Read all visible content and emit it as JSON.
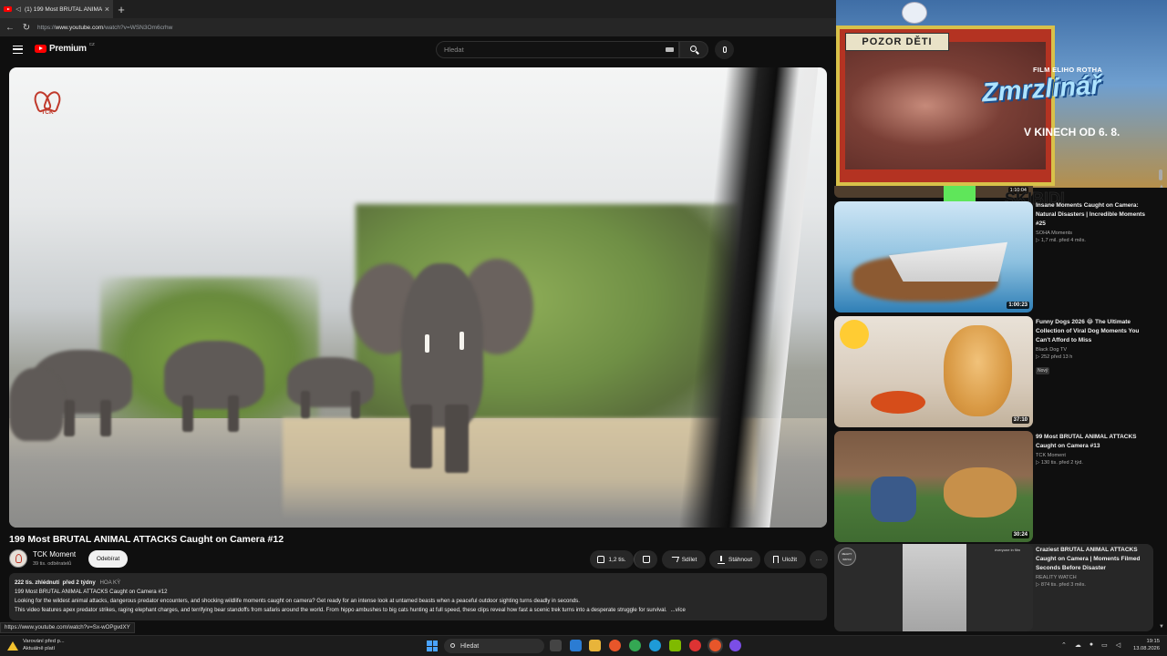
{
  "browser": {
    "tab_title": "(1) 199 Most BRUTAL ANIMAL",
    "url_prefix": "https://",
    "url_domain": "www.youtube.com",
    "url_path": "/watch?v=WSN3Om6crhw"
  },
  "header": {
    "logo_text": "Premium",
    "logo_country": "CZ",
    "search_placeholder": "Hledat"
  },
  "video": {
    "watermark": "TCK",
    "title": "199 Most BRUTAL ANIMAL ATTACKS Caught on Camera #12",
    "channel": "TCK Moment",
    "subscribers": "39 tis. odběratelů",
    "subscribe_label": "Odebírat",
    "likes": "1,2 tis.",
    "share_label": "Sdílet",
    "download_label": "Stáhnout",
    "save_label": "Uložit",
    "more_label": "···"
  },
  "description": {
    "views": "222 tis. zhlédnutí",
    "date": "před 2 týdny",
    "tag": "HOA KỲ",
    "line1": "199 Most BRUTAL ANIMAL ATTACKS Caught on Camera #12",
    "line2": "Looking for the wildest animal attacks, dangerous predator encounters, and shocking wildlife moments caught on camera? Get ready for an intense look at untamed beasts when a peaceful outdoor sighting turns deadly in seconds.",
    "line3": "This video features apex predator strikes, raging elephant charges, and terrifying bear standoffs from safaris around the world. From hippo ambushes to big cats hunting at full speed, these clips reveal how fast a scenic trek turns into a desperate struggle for survival.",
    "more": "...více"
  },
  "status_url": "https://www.youtube.com/watch?v=Sx-wOPgvdXY",
  "ad": {
    "sign": "POZOR DĚTI",
    "subtitle": "FILM ELIHO ROTHA",
    "title": "Zmrzlinář",
    "date": "V KINECH OD 6. 8."
  },
  "peek": {
    "duration": "1:10:04",
    "logo": "SKIBIDI"
  },
  "recommendations": [
    {
      "title": "Insane Moments Caught on Camera: Natural Disasters | Incredible Moments #25",
      "channel": "SOHA Moments",
      "meta": "▷ 1,7 mil.  před 4 měs.",
      "duration": "1:00:23"
    },
    {
      "title": "Funny Dogs 2026 😂 The Ultimate Collection of Viral Dog Moments You Can't Afford to Miss",
      "channel": "Black Dog TV",
      "meta": "▷ 252  před 13 h",
      "badge": "Nový",
      "duration": "37:10"
    },
    {
      "title": "99 Most BRUTAL ANIMAL ATTACKS Caught on Camera #13",
      "channel": "TCK Moment",
      "meta": "▷ 130 tis.  před 2 týd.",
      "duration": "30:24"
    },
    {
      "title": "Craziest BRUTAL ANIMAL ATTACKS Caught on Camera | Moments Filmed Seconds Before Disaster",
      "channel": "REALITY WATCH",
      "meta": "▷ 874 tis.  před 3 měs.",
      "thumb_logo": "REALITY WATCH",
      "thumb_caption": "everyone in film"
    }
  ],
  "taskbar": {
    "warning_line1": "Varování před p...",
    "warning_line2": "Aktuálně platí",
    "search_label": "Hledat",
    "time": "19:15",
    "date": "13.08.2026"
  },
  "colors": {
    "brand_red": "#ff0000",
    "background": "#0f0f0f",
    "surface": "#272727"
  }
}
